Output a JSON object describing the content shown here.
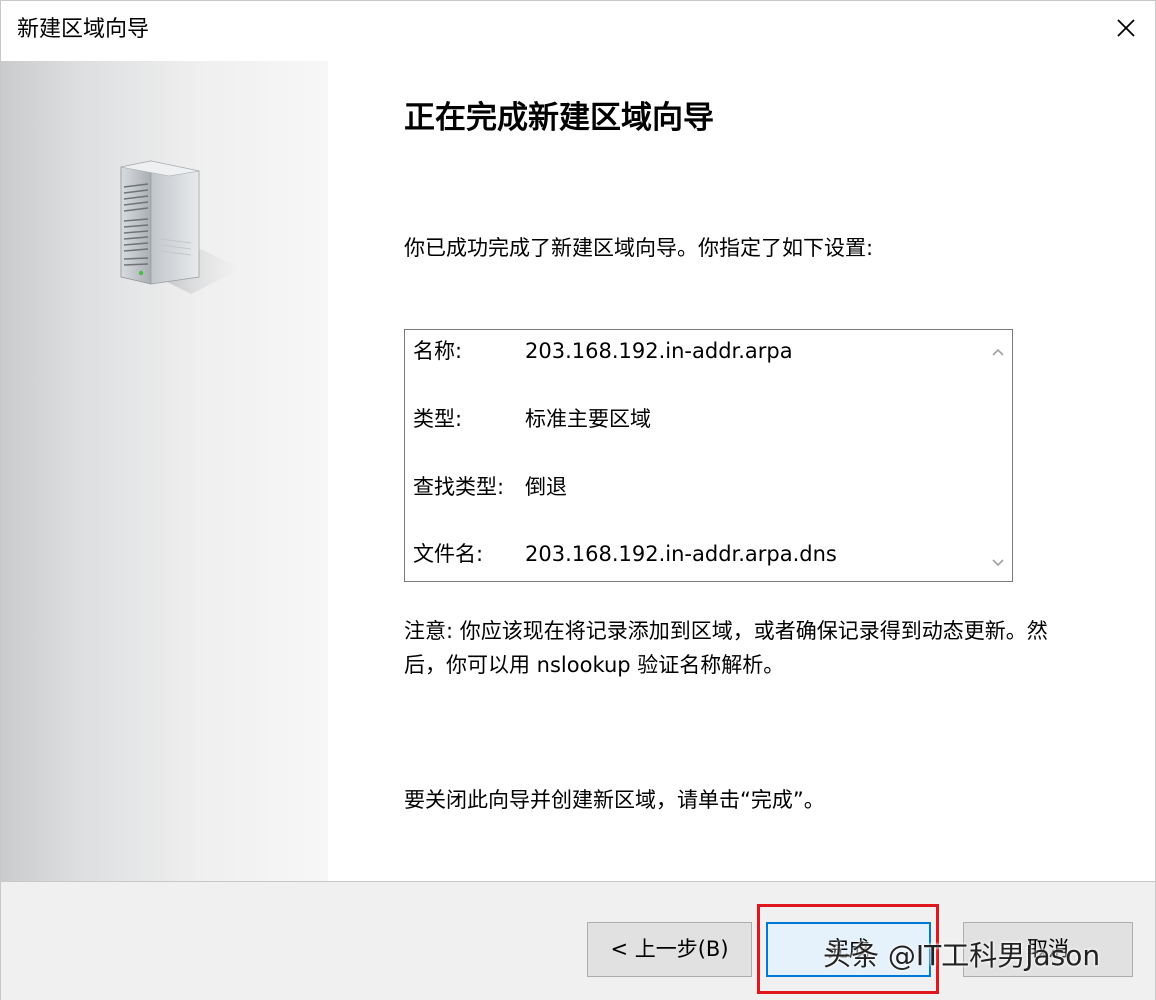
{
  "window": {
    "title": "新建区域向导",
    "close_icon": "close-icon"
  },
  "side_panel": {
    "illustration_icon": "server-icon"
  },
  "main": {
    "heading": "正在完成新建区域向导",
    "intro": "你已成功完成了新建区域向导。你指定了如下设置:",
    "summary": [
      {
        "label": "名称:",
        "value": "203.168.192.in-addr.arpa"
      },
      {
        "label": "类型:",
        "value": "标准主要区域"
      },
      {
        "label": "查找类型:",
        "value": "倒退"
      },
      {
        "label": "文件名:",
        "value": "203.168.192.in-addr.arpa.dns"
      }
    ],
    "note": "注意: 你应该现在将记录添加到区域，或者确保记录得到动态更新。然后，你可以用 nslookup 验证名称解析。",
    "closing": "要关闭此向导并创建新区域，请单击“完成”。"
  },
  "footer": {
    "back_label": "< 上一步(B)",
    "finish_label": "完成",
    "cancel_label": "取消",
    "watermark": "头条 @IT工科男Jason",
    "highlight_color": "#e0161e",
    "focus_color": "#0078d7"
  }
}
